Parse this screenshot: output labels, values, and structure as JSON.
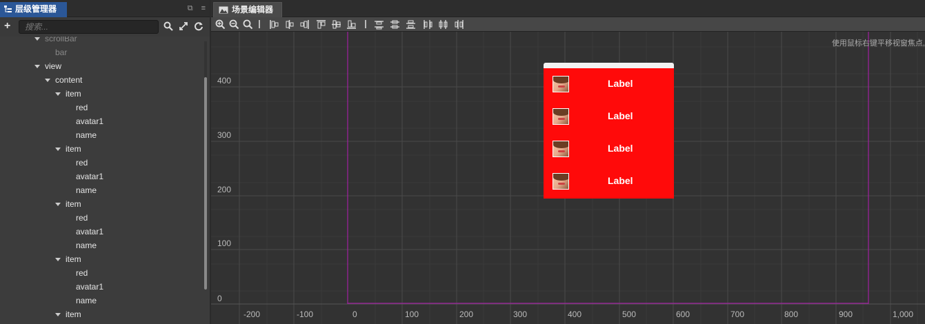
{
  "hierarchy_panel": {
    "title": "层级管理器",
    "search_placeholder": "搜索...",
    "tree": [
      {
        "label": "scrollBar",
        "expanded": true
      },
      {
        "label": "bar"
      },
      {
        "label": "view",
        "expanded": true
      },
      {
        "label": "content",
        "expanded": true
      },
      {
        "label": "item",
        "expanded": true
      },
      {
        "label": "red"
      },
      {
        "label": "avatar1"
      },
      {
        "label": "name"
      },
      {
        "label": "item",
        "expanded": true
      },
      {
        "label": "red"
      },
      {
        "label": "avatar1"
      },
      {
        "label": "name"
      },
      {
        "label": "item",
        "expanded": true
      },
      {
        "label": "red"
      },
      {
        "label": "avatar1"
      },
      {
        "label": "name"
      },
      {
        "label": "item",
        "expanded": true
      },
      {
        "label": "red"
      },
      {
        "label": "avatar1"
      },
      {
        "label": "name"
      },
      {
        "label": "item",
        "expanded": true
      }
    ]
  },
  "scene_panel": {
    "title": "场景编辑器",
    "hint": "使用鼠标右键平移视窗焦点,",
    "y_labels": [
      "400",
      "300",
      "200",
      "100",
      "0"
    ],
    "x_labels": [
      "-200",
      "-100",
      "0",
      "100",
      "200",
      "300",
      "400",
      "500",
      "600",
      "700",
      "800",
      "900",
      "1,000"
    ],
    "items": [
      {
        "label": "Label"
      },
      {
        "label": "Label"
      },
      {
        "label": "Label"
      },
      {
        "label": "Label"
      }
    ]
  },
  "colors": {
    "accent": "#2b5797",
    "node_background": "#ff0a0a",
    "canvas_border": "#a020a0"
  }
}
